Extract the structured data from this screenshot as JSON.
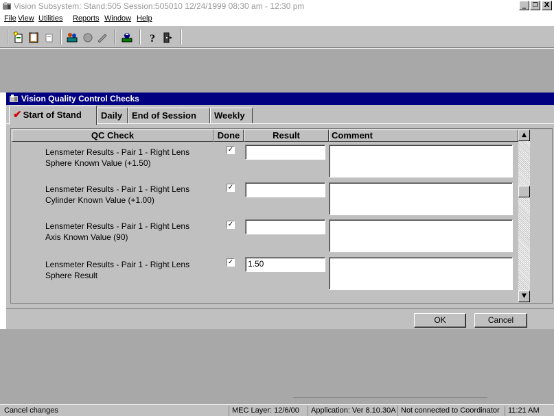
{
  "window": {
    "title": "Vision Subsystem: Stand:505 Session:505010 12/24/1999 08:30 am - 12:30 pm",
    "controls": [
      "_",
      "❐",
      "X"
    ]
  },
  "menu": [
    "File",
    "View",
    "Utilities",
    "Reports",
    "Window",
    "Help"
  ],
  "toolbar_icons": [
    "new-icon",
    "clipboard-icon",
    "document-icon",
    "people-icon",
    "stop-icon",
    "pen-icon",
    "tools-icon",
    "help-icon",
    "exit-icon"
  ],
  "child": {
    "title": "Vision Quality Control Checks",
    "tabs": [
      {
        "label": "Start of Stand",
        "active": true,
        "checked": true
      },
      {
        "label": "Daily"
      },
      {
        "label": "End of Session"
      },
      {
        "label": "Weekly"
      }
    ],
    "columns": {
      "qc": "QC Check",
      "done": "Done",
      "result": "Result",
      "comment": "Comment"
    },
    "rows": [
      {
        "line1": "Lensmeter Results - Pair 1 - Right Lens",
        "line2": "Sphere Known Value (+1.50)",
        "done": true,
        "result": "",
        "comment": ""
      },
      {
        "line1": "Lensmeter Results - Pair 1 - Right Lens",
        "line2": "Cylinder Known Value (+1.00)",
        "done": true,
        "result": "",
        "comment": ""
      },
      {
        "line1": "Lensmeter Results - Pair 1 - Right Lens",
        "line2": "Axis Known Value (90)",
        "done": true,
        "result": "",
        "comment": ""
      },
      {
        "line1": "Lensmeter Results - Pair 1 - Right Lens",
        "line2": "Sphere Result",
        "done": true,
        "result": "1.50",
        "comment": ""
      }
    ],
    "buttons": {
      "ok": "OK",
      "cancel": "Cancel"
    }
  },
  "status": {
    "message": "Cancel changes",
    "layer": "MEC Layer: 12/6/00",
    "application": "Application: Ver 8.10.30A",
    "connection": "Not connected to Coordinator",
    "time": "11:21 AM"
  }
}
